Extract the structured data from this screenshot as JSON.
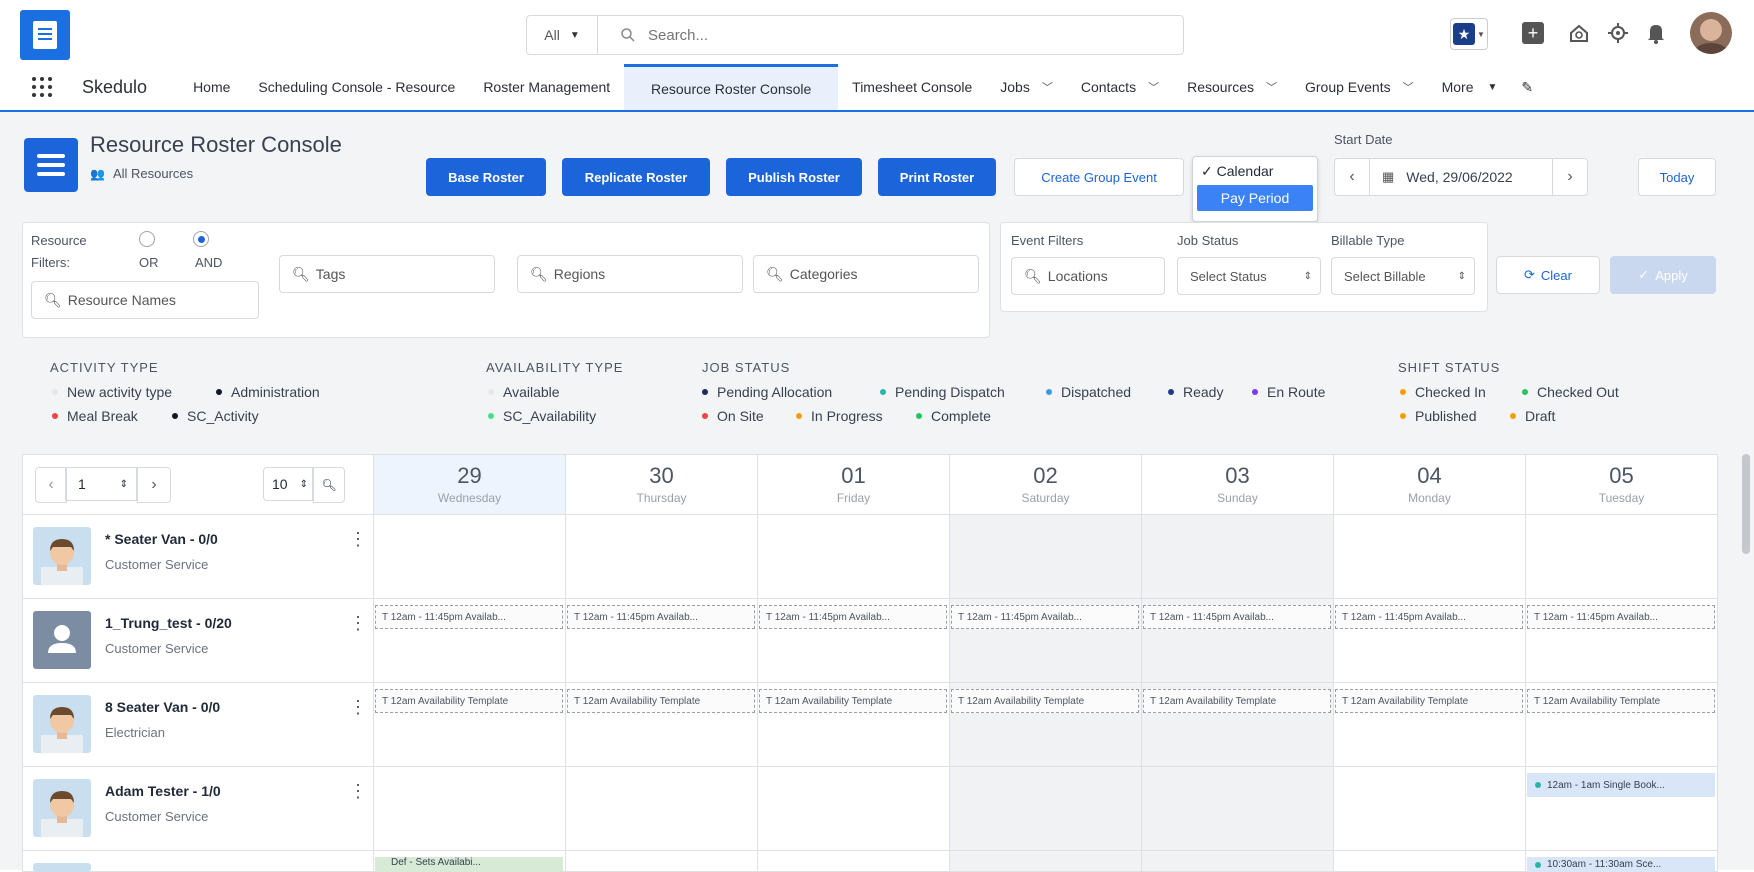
{
  "search": {
    "scope": "All",
    "placeholder": "Search..."
  },
  "nav": {
    "app_name": "Skedulo",
    "items": [
      {
        "label": "Home",
        "chevron": false
      },
      {
        "label": "Scheduling Console - Resource",
        "chevron": false
      },
      {
        "label": "Roster Management",
        "chevron": false
      },
      {
        "label": "Resource Roster Console",
        "chevron": false,
        "active": true
      },
      {
        "label": "Timesheet Console",
        "chevron": false
      },
      {
        "label": "Jobs",
        "chevron": true
      },
      {
        "label": "Contacts",
        "chevron": true
      },
      {
        "label": "Resources",
        "chevron": true
      },
      {
        "label": "Group Events",
        "chevron": true
      }
    ],
    "more_label": "More"
  },
  "console": {
    "title": "Resource Roster Console",
    "subtitle": "All Resources",
    "buttons": {
      "base": "Base Roster",
      "replicate": "Replicate Roster",
      "publish": "Publish Roster",
      "print": "Print Roster",
      "create_group": "Create Group Event"
    },
    "view_menu": {
      "option_calendar": "✓ Calendar",
      "option_pay_period": "Pay Period"
    },
    "start_date_label": "Start Date",
    "start_date_value": "Wed, 29/06/2022",
    "today_label": "Today"
  },
  "filters": {
    "resource_filters_label_1": "Resource",
    "resource_filters_label_2": "Filters:",
    "or_label": "OR",
    "and_label": "AND",
    "tags": "Tags",
    "regions": "Regions",
    "categories": "Categories",
    "resource_names": "Resource Names",
    "event_filters_label": "Event Filters",
    "locations": "Locations",
    "job_status_label": "Job Status",
    "job_status_value": "Select Status",
    "billable_label": "Billable Type",
    "billable_value": "Select Billable",
    "clear_label": "Clear",
    "apply_label": "Apply"
  },
  "legend": {
    "activity": {
      "title": "ACTIVITY TYPE",
      "items": [
        "New activity type",
        "Administration",
        "Meal Break",
        "SC_Activity"
      ]
    },
    "availability": {
      "title": "AVAILABILITY TYPE",
      "items": [
        "Available",
        "SC_Availability"
      ]
    },
    "job": {
      "title": "JOB STATUS",
      "items": [
        "Pending Allocation",
        "Pending Dispatch",
        "Dispatched",
        "Ready",
        "En Route",
        "On Site",
        "In Progress",
        "Complete"
      ]
    },
    "shift": {
      "title": "SHIFT STATUS",
      "items": [
        "Checked In",
        "Checked Out",
        "Published",
        "Draft"
      ]
    }
  },
  "colors": {
    "primary": "#1c64d9",
    "new_activity": "#e5e7eb",
    "administration": "#111827",
    "meal_break": "#ef4444",
    "sc_activity": "#111827",
    "sc_availability": "#4ade80",
    "pending_allocation": "#1f2a5a",
    "pending_dispatch": "#2bb3a8",
    "dispatched": "#3b9be8",
    "ready": "#1e3a8a",
    "en_route": "#7c3aed",
    "on_site": "#ef4444",
    "in_progress": "#f59e0b",
    "complete": "#22c55e",
    "checked_in": "#f59e0b",
    "checked_out": "#22c55e",
    "published": "#f59e0b",
    "draft": "#f59e0b"
  },
  "pager": {
    "page": "1",
    "per_page": "10"
  },
  "days": [
    {
      "num": "29",
      "name": "Wednesday"
    },
    {
      "num": "30",
      "name": "Thursday"
    },
    {
      "num": "01",
      "name": "Friday"
    },
    {
      "num": "02",
      "name": "Saturday"
    },
    {
      "num": "03",
      "name": "Sunday"
    },
    {
      "num": "04",
      "name": "Monday"
    },
    {
      "num": "05",
      "name": "Tuesday"
    }
  ],
  "resources": [
    {
      "name": "* Seater Van - 0/0",
      "role": "Customer Service"
    },
    {
      "name": "1_Trung_test - 0/20",
      "role": "Customer Service"
    },
    {
      "name": "8 Seater Van - 0/0",
      "role": "Electrician"
    },
    {
      "name": "Adam Tester - 1/0",
      "role": "Customer Service"
    }
  ],
  "events": {
    "row2_text": "T 12am - 11:45pm Availab...",
    "row3_text": "T 12am Availability Template",
    "row4_text": "12am - 1am Single Book...",
    "row5_text": "10:30am - 11:30am Sce...",
    "row5_first": "Def - Sets Availabi..."
  }
}
